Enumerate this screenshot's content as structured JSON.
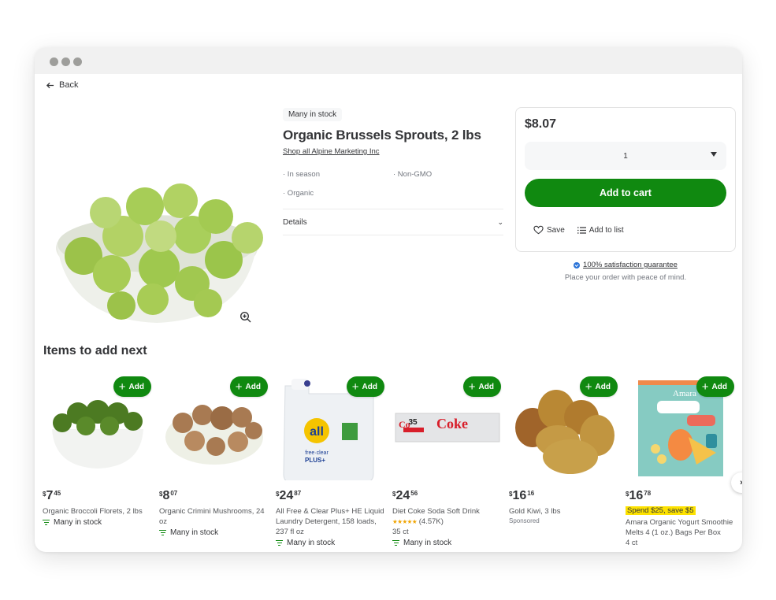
{
  "window": {
    "controls": [
      "close",
      "minimize",
      "maximize"
    ]
  },
  "nav": {
    "back_label": "Back",
    "back_icon": "arrow-left-icon"
  },
  "product": {
    "stock_badge": "Many in stock",
    "title": "Organic Brussels Sprouts, 2 lbs",
    "shop_link": "Shop all Alpine Marketing Inc",
    "attributes": [
      "· In season",
      "· Non-GMO",
      "· Organic"
    ],
    "details_label": "Details",
    "image_alt": "Bowl of brussels sprouts",
    "zoom_icon": "zoom-in-icon"
  },
  "buybox": {
    "price": "$8.07",
    "quantity": "1",
    "add_to_cart": "Add to cart",
    "save_label": "Save",
    "add_to_list_label": "Add to list"
  },
  "guarantee": {
    "link": "100% satisfaction guarantee",
    "subtext": "Place your order with peace of mind."
  },
  "recommendations": {
    "title": "Items to add next",
    "add_label": "Add",
    "items": [
      {
        "price_dollars": "7",
        "price_cents": "45",
        "name": "Organic Broccoli Florets, 2 lbs",
        "stock": "Many in stock"
      },
      {
        "price_dollars": "8",
        "price_cents": "07",
        "name": "Organic Crimini Mushrooms, 24 oz",
        "stock": "Many in stock"
      },
      {
        "price_dollars": "24",
        "price_cents": "87",
        "name": "All Free & Clear Plus+ HE Liquid Laundry Detergent, 158 loads, 237 fl oz",
        "stock": "Many in stock"
      },
      {
        "price_dollars": "24",
        "price_cents": "56",
        "name": "Diet Coke Soda Soft Drink",
        "rating_stars": "★★★★★",
        "rating_count": "(4.57K)",
        "size": "35 ct",
        "stock": "Many in stock"
      },
      {
        "price_dollars": "16",
        "price_cents": "16",
        "name": "Gold Kiwi, 3 lbs",
        "sponsored": "Sponsored"
      },
      {
        "price_dollars": "16",
        "price_cents": "78",
        "promo": "Spend $25, save $5",
        "name": "Amara Organic Yogurt Smoothie Melts 4 (1 oz.) Bags Per Box",
        "size": "4 ct"
      }
    ],
    "currency": "$"
  },
  "colors": {
    "brand_green": "#108910",
    "promo_yellow": "#fde200",
    "guarantee_blue": "#2a73d8"
  }
}
